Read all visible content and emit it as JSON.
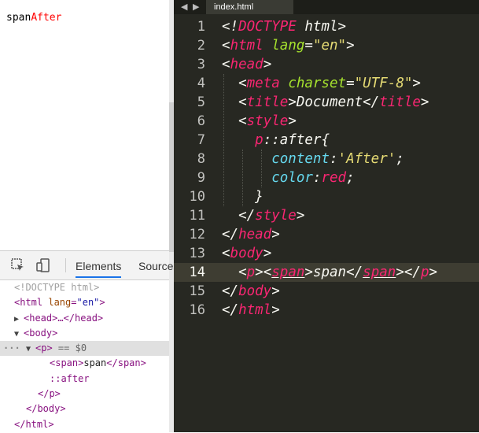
{
  "rendered_page": {
    "text": "span",
    "after_text": "After",
    "after_color": "#ff0000"
  },
  "devtools": {
    "tabs": [
      {
        "label": "Elements",
        "active": true
      },
      {
        "label": "Sources",
        "active": false
      }
    ],
    "tree": {
      "doctype": "<!DOCTYPE html>",
      "html_open": "<html",
      "lang_attr": "lang",
      "lang_val": "\"en\"",
      "head_collapsed": "<head>…</head>",
      "body_open": "<body>",
      "p_open": "<p>",
      "p_marker": "== $0",
      "span_open": "<span>",
      "span_text": "span",
      "span_close": "</span>",
      "after_pseudo": "::after",
      "p_close": "</p>",
      "body_close": "</body>",
      "html_close": "</html>",
      "dots": "···"
    }
  },
  "editor": {
    "tab_title": "index.html",
    "current_line": 14,
    "line_numbers": [
      "1",
      "2",
      "3",
      "4",
      "5",
      "6",
      "7",
      "8",
      "9",
      "10",
      "11",
      "12",
      "13",
      "14",
      "15",
      "16"
    ]
  },
  "colors": {
    "editor_bg": "#272822",
    "tag": "#f92672",
    "attr": "#a6e22e",
    "string": "#e6db74",
    "property": "#66d9ef"
  }
}
